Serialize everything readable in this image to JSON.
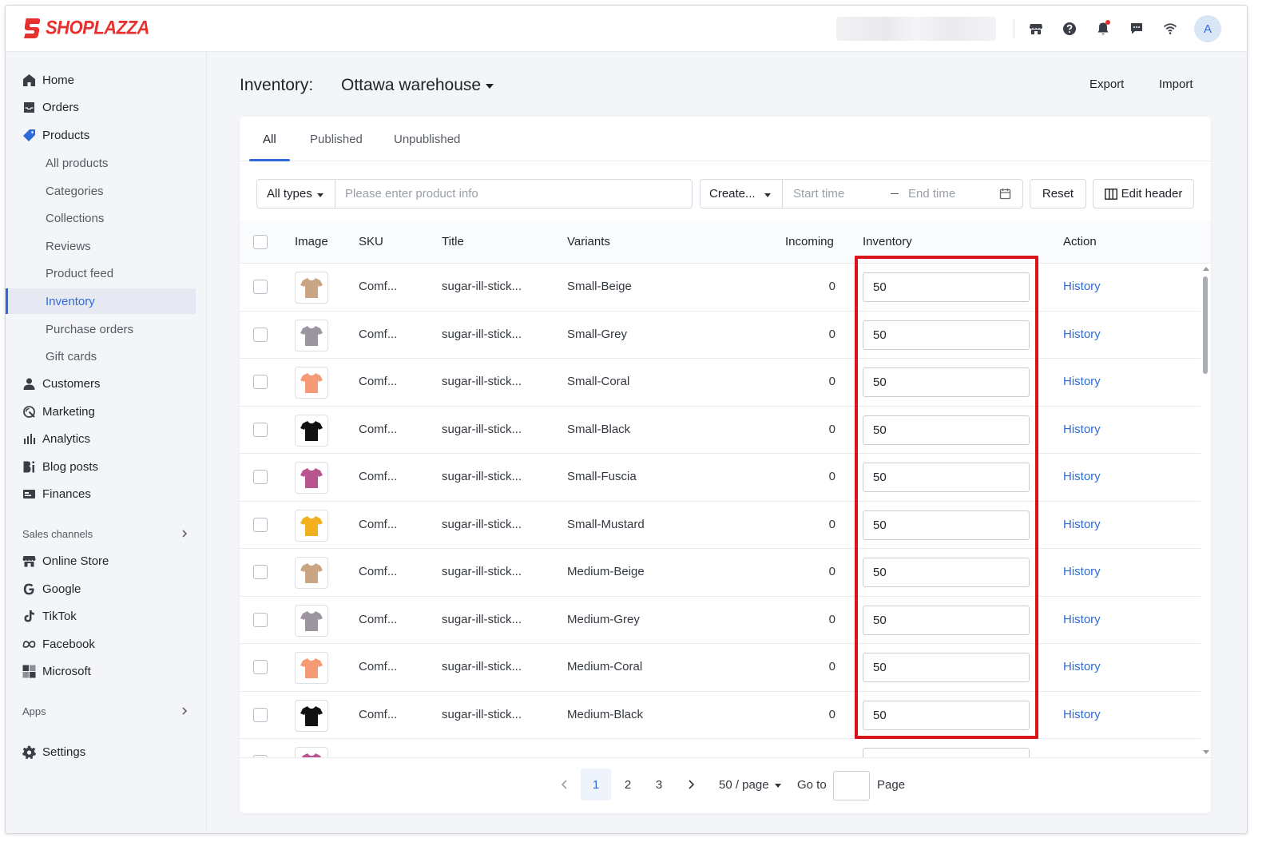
{
  "brand": {
    "name": "SHOPLAZZA",
    "color": "#e6312f"
  },
  "accent": "#2f6bd8",
  "topbar": {
    "icons": [
      "store-icon",
      "help-icon",
      "bell-icon",
      "chat-icon",
      "wifi-icon"
    ],
    "avatar_initial": "A"
  },
  "sidebar": {
    "main": [
      {
        "label": "Home",
        "icon": "home-icon"
      },
      {
        "label": "Orders",
        "icon": "orders-icon"
      },
      {
        "label": "Products",
        "icon": "tag-icon"
      }
    ],
    "products_sub": [
      {
        "label": "All products"
      },
      {
        "label": "Categories"
      },
      {
        "label": "Collections"
      },
      {
        "label": "Reviews"
      },
      {
        "label": "Product feed"
      },
      {
        "label": "Inventory",
        "active": true
      },
      {
        "label": "Purchase orders"
      },
      {
        "label": "Gift cards"
      }
    ],
    "more": [
      {
        "label": "Customers",
        "icon": "person-icon"
      },
      {
        "label": "Marketing",
        "icon": "marketing-icon"
      },
      {
        "label": "Analytics",
        "icon": "bar-chart-icon"
      },
      {
        "label": "Blog posts",
        "icon": "blog-icon"
      },
      {
        "label": "Finances",
        "icon": "finance-icon"
      }
    ],
    "sales_channels_label": "Sales channels",
    "channels": [
      {
        "label": "Online Store",
        "icon": "store-icon"
      },
      {
        "label": "Google",
        "icon": "google-icon"
      },
      {
        "label": "TikTok",
        "icon": "tiktok-icon"
      },
      {
        "label": "Facebook",
        "icon": "meta-icon"
      },
      {
        "label": "Microsoft",
        "icon": "microsoft-icon"
      }
    ],
    "apps_label": "Apps",
    "settings_label": "Settings"
  },
  "header": {
    "title": "Inventory:",
    "warehouse": "Ottawa warehouse",
    "export": "Export",
    "import": "Import"
  },
  "tabs": [
    {
      "label": "All",
      "active": true
    },
    {
      "label": "Published"
    },
    {
      "label": "Unpublished"
    }
  ],
  "filters": {
    "types": "All types",
    "search_placeholder": "Please enter product info",
    "create": "Create...",
    "start_placeholder": "Start time",
    "end_placeholder": "End time",
    "reset": "Reset",
    "edit_header": "Edit header"
  },
  "table": {
    "columns": [
      "Image",
      "SKU",
      "Title",
      "Variants",
      "Incoming",
      "Inventory",
      "Action"
    ],
    "rows": [
      {
        "sku": "Comf...",
        "title": "sugar-ill-stick...",
        "variant": "Small-Beige",
        "incoming": "0",
        "inventory": "50",
        "action": "History",
        "color": "#c9a583"
      },
      {
        "sku": "Comf...",
        "title": "sugar-ill-stick...",
        "variant": "Small-Grey",
        "incoming": "0",
        "inventory": "50",
        "action": "History",
        "color": "#9c95a0"
      },
      {
        "sku": "Comf...",
        "title": "sugar-ill-stick...",
        "variant": "Small-Coral",
        "incoming": "0",
        "inventory": "50",
        "action": "History",
        "color": "#f59a74"
      },
      {
        "sku": "Comf...",
        "title": "sugar-ill-stick...",
        "variant": "Small-Black",
        "incoming": "0",
        "inventory": "50",
        "action": "History",
        "color": "#111111"
      },
      {
        "sku": "Comf...",
        "title": "sugar-ill-stick...",
        "variant": "Small-Fuscia",
        "incoming": "0",
        "inventory": "50",
        "action": "History",
        "color": "#b8558f"
      },
      {
        "sku": "Comf...",
        "title": "sugar-ill-stick...",
        "variant": "Small-Mustard",
        "incoming": "0",
        "inventory": "50",
        "action": "History",
        "color": "#f2b01e"
      },
      {
        "sku": "Comf...",
        "title": "sugar-ill-stick...",
        "variant": "Medium-Beige",
        "incoming": "0",
        "inventory": "50",
        "action": "History",
        "color": "#c9a583"
      },
      {
        "sku": "Comf...",
        "title": "sugar-ill-stick...",
        "variant": "Medium-Grey",
        "incoming": "0",
        "inventory": "50",
        "action": "History",
        "color": "#9c95a0"
      },
      {
        "sku": "Comf...",
        "title": "sugar-ill-stick...",
        "variant": "Medium-Coral",
        "incoming": "0",
        "inventory": "50",
        "action": "History",
        "color": "#f59a74"
      },
      {
        "sku": "Comf...",
        "title": "sugar-ill-stick...",
        "variant": "Medium-Black",
        "incoming": "0",
        "inventory": "50",
        "action": "History",
        "color": "#111111"
      },
      {
        "sku": "",
        "title": "",
        "variant": "",
        "incoming": "",
        "inventory": "",
        "action": "",
        "color": "#b8558f"
      }
    ]
  },
  "highlight_color": "#d8151b",
  "pagination": {
    "pages": [
      "1",
      "2",
      "3"
    ],
    "current": "1",
    "page_size": "50 / page",
    "goto_label": "Go to",
    "page_label": "Page"
  }
}
